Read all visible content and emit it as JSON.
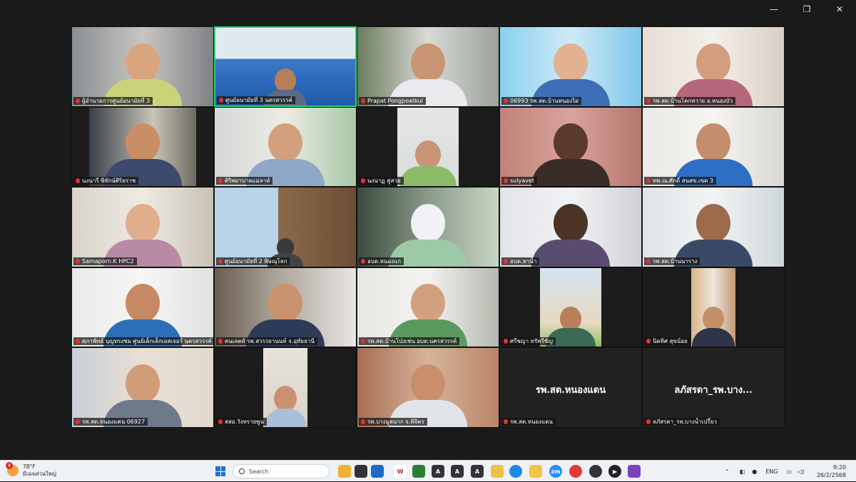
{
  "window": {
    "controls": {
      "minimize": "—",
      "maximize": "❐",
      "close": "✕"
    }
  },
  "tiles": [
    {
      "name": "ผู้อำนวยการศูนย์อนามัยที่ 3"
    },
    {
      "name": "ศูนย์อนามัยที่ 3 นครสวรรค์",
      "active": true
    },
    {
      "name": "Prapat Pongpoatkul"
    },
    {
      "name": "06993 รพ.สต.บ้านหนองไผ่"
    },
    {
      "name": "รพ.สต.บ้านโคกหวาย อ.หนองบัว"
    },
    {
      "name": "นงนารี พิทักษ์ศิริยราช"
    },
    {
      "name": "ศิริพยาบาลแม่ลาห์"
    },
    {
      "name": "นงนาฏ คู่สวย"
    },
    {
      "name": "sulyavet"
    },
    {
      "name": "ทพ.ณ.ศักดิ์ สนสข.เขต 3"
    },
    {
      "name": "Samaporn.K HPC2"
    },
    {
      "name": "ศูนย์อนามัยที่ 2 พิษณุโลก"
    },
    {
      "name": "อบต.หนองแก"
    },
    {
      "name": "อบต.หาน้ำ"
    },
    {
      "name": "รพ.สต.บ้านนาราง"
    },
    {
      "name": "ศุภาพัทธ์ บุญทรงชม ศูนย์เด็กเล็กเอสเจอร์ นครสวรรค์"
    },
    {
      "name": "คนเลตส์ รพ.สวรรยานนท์ จ.อุทัยธานี"
    },
    {
      "name": "รพ.สต.บ้านโป่งเช่น อบต.นครสวรรค์"
    },
    {
      "name": "ศรีชญา ทรัพรีชัญ"
    },
    {
      "name": "นิดทิศ สุขน้อย"
    },
    {
      "name": "รพ.สต.หนองแคน 06927"
    },
    {
      "name": "สสอ.วังทรายพูน"
    },
    {
      "name": "รพ.บางมูลนาก จ.พิจิตร"
    },
    {
      "name": "รพ.สต.หนองแดน",
      "center": "รพ.สต.หนองแดน"
    },
    {
      "name": "ลภัสรดา_รพ.บางน้ำเปรี้ยว",
      "center": "ลภัสรดา_รพ.บาง..."
    }
  ],
  "taskbar": {
    "weather": {
      "temp": "78°F",
      "desc": "มีเมฆส่วนใหญ่",
      "badge": "4"
    },
    "search_placeholder": "Search",
    "tray": {
      "lang": "ENG"
    },
    "clock": {
      "time": "9:20",
      "date": "26/2/2568"
    }
  },
  "colors": {
    "active_border": "#2bd46b",
    "mic_muted": "#e03131",
    "taskbar": "#eef1f6"
  }
}
